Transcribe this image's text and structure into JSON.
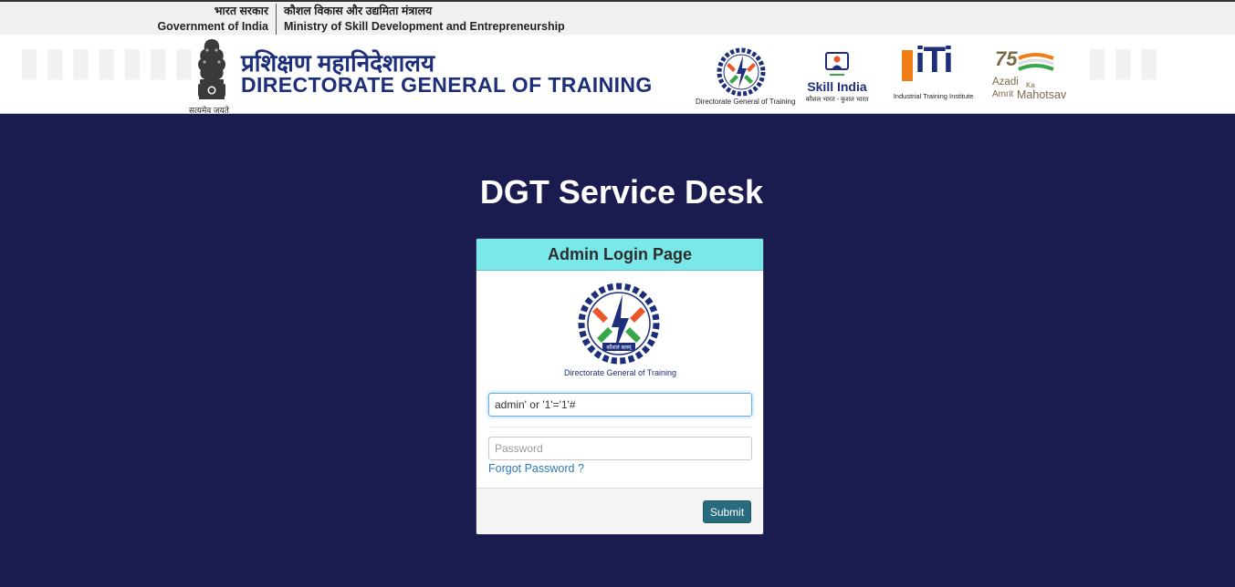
{
  "topbar": {
    "gov_hindi": "भारत सरकार",
    "gov_english": "Government of India",
    "ministry_hindi": "कौशल विकास और उद्यमिता मंत्रालय",
    "ministry_english": "Ministry of Skill Development and Entrepreneurship"
  },
  "header": {
    "emblem_caption": "सत्यमेव जयते",
    "title_hindi": "प्रशिक्षण महानिदेशालय",
    "title_english": "DIRECTORATE GENERAL OF TRAINING",
    "logos": {
      "dgt": "Directorate General of Training",
      "skill_title": "Skill India",
      "skill_sub": "कौशल भारत - कुशल भारत",
      "iti_mark": "iTi",
      "iti_sub": "Industrial Training Institute",
      "azadi_mark": "75",
      "azadi_line1": "Azadi",
      "azadi_ka": "Ka",
      "azadi_line2": "Amrit",
      "azadi_line3": "Mahotsav"
    }
  },
  "page_title": "DGT Service Desk",
  "login": {
    "heading": "Admin Login Page",
    "logo_caption": "Directorate General of Training",
    "logo_motto": "कौशलं बलम्",
    "username_value": "admin' or '1'='1'#",
    "password_placeholder": "Password",
    "forgot_label": "Forgot Password ?",
    "submit_label": "Submit"
  },
  "colors": {
    "background": "#1a1c4f",
    "card_header": "#7ae8e8",
    "submit_button": "#286b7f",
    "link": "#2a7ab8",
    "title_blue": "#1d2e7a"
  }
}
